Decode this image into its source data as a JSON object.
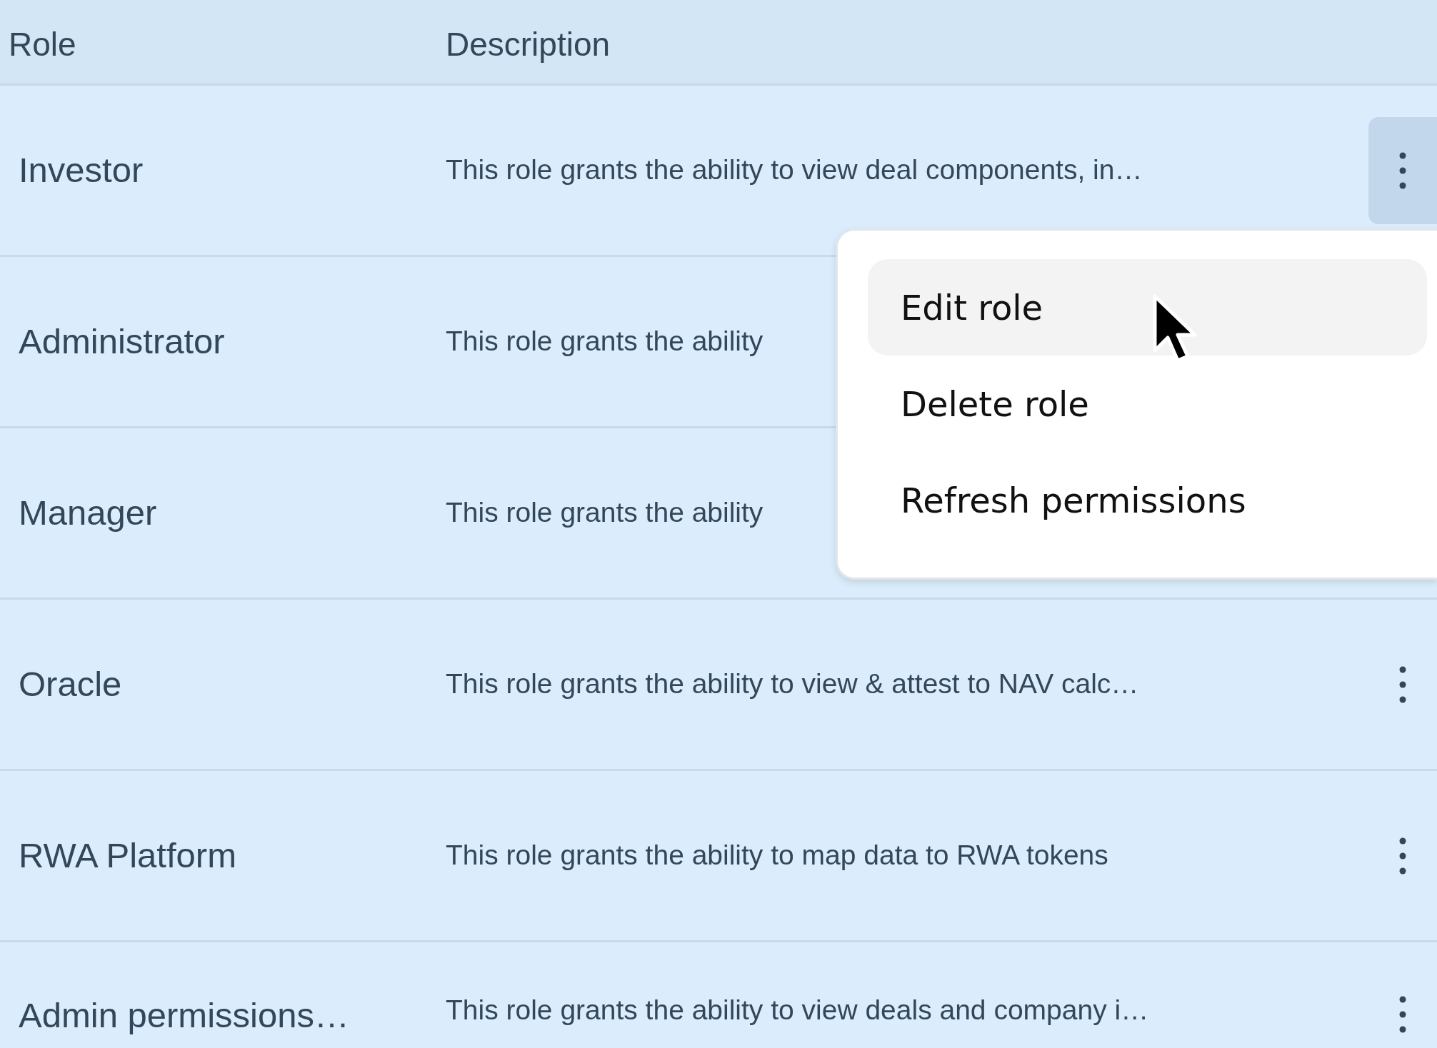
{
  "table": {
    "columns": [
      "Role",
      "Description"
    ],
    "rows": [
      {
        "role": "Investor",
        "description": "This role grants the ability to view deal components, in…",
        "menu_button": true,
        "selected": true
      },
      {
        "role": "Administrator",
        "description": "This role grants the ability",
        "menu_button": false,
        "selected": false
      },
      {
        "role": "Manager",
        "description": "This role grants the ability",
        "menu_button": false,
        "selected": false
      },
      {
        "role": "Oracle",
        "description": "This role grants the ability to view & attest to NAV calc…",
        "menu_button": true,
        "selected": false
      },
      {
        "role": "RWA Platform",
        "description": "This role grants the ability to map data to RWA tokens",
        "menu_button": true,
        "selected": false
      },
      {
        "role": "Admin permissions…",
        "description": "This role grants the ability to view deals and company i…",
        "menu_button": true,
        "selected": false
      }
    ]
  },
  "context_menu": {
    "items": [
      {
        "label": "Edit role",
        "selected": true
      },
      {
        "label": "Delete role",
        "selected": false
      },
      {
        "label": "Refresh permissions",
        "selected": false
      }
    ]
  }
}
